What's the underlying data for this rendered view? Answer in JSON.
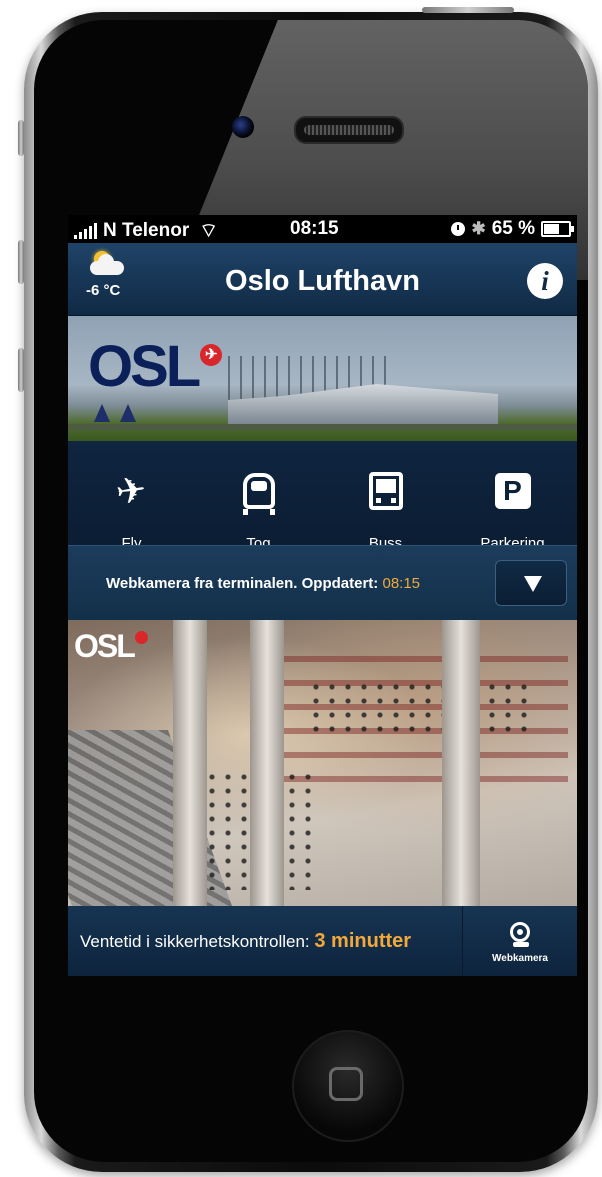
{
  "statusbar": {
    "carrier": "N Telenor",
    "time": "08:15",
    "battery": "65 %"
  },
  "navbar": {
    "temperature": "-6 °C",
    "title": "Oslo Lufthavn",
    "info_label": "i",
    "weather_icon": "partly-cloudy-icon"
  },
  "banner": {
    "logo_text": "OSL"
  },
  "tabs": [
    {
      "label": "Fly",
      "icon": "airplane-icon"
    },
    {
      "label": "Tog",
      "icon": "train-icon"
    },
    {
      "label": "Buss",
      "icon": "bus-icon"
    },
    {
      "label": "Parkering",
      "icon": "parking-icon"
    }
  ],
  "webcam_bar": {
    "caption": "Webkamera fra terminalen. Oppdatert:",
    "updated_time": "08:15"
  },
  "webcam": {
    "logo_text": "OSL"
  },
  "bottombar": {
    "wait_label": "Ventetid i sikkerhetskontrollen:",
    "wait_value": "3 minutter",
    "webcam_button_label": "Webkamera"
  },
  "colors": {
    "accent": "#f2a93b",
    "navy": "#0d2239",
    "logo_red": "#d8262a"
  }
}
